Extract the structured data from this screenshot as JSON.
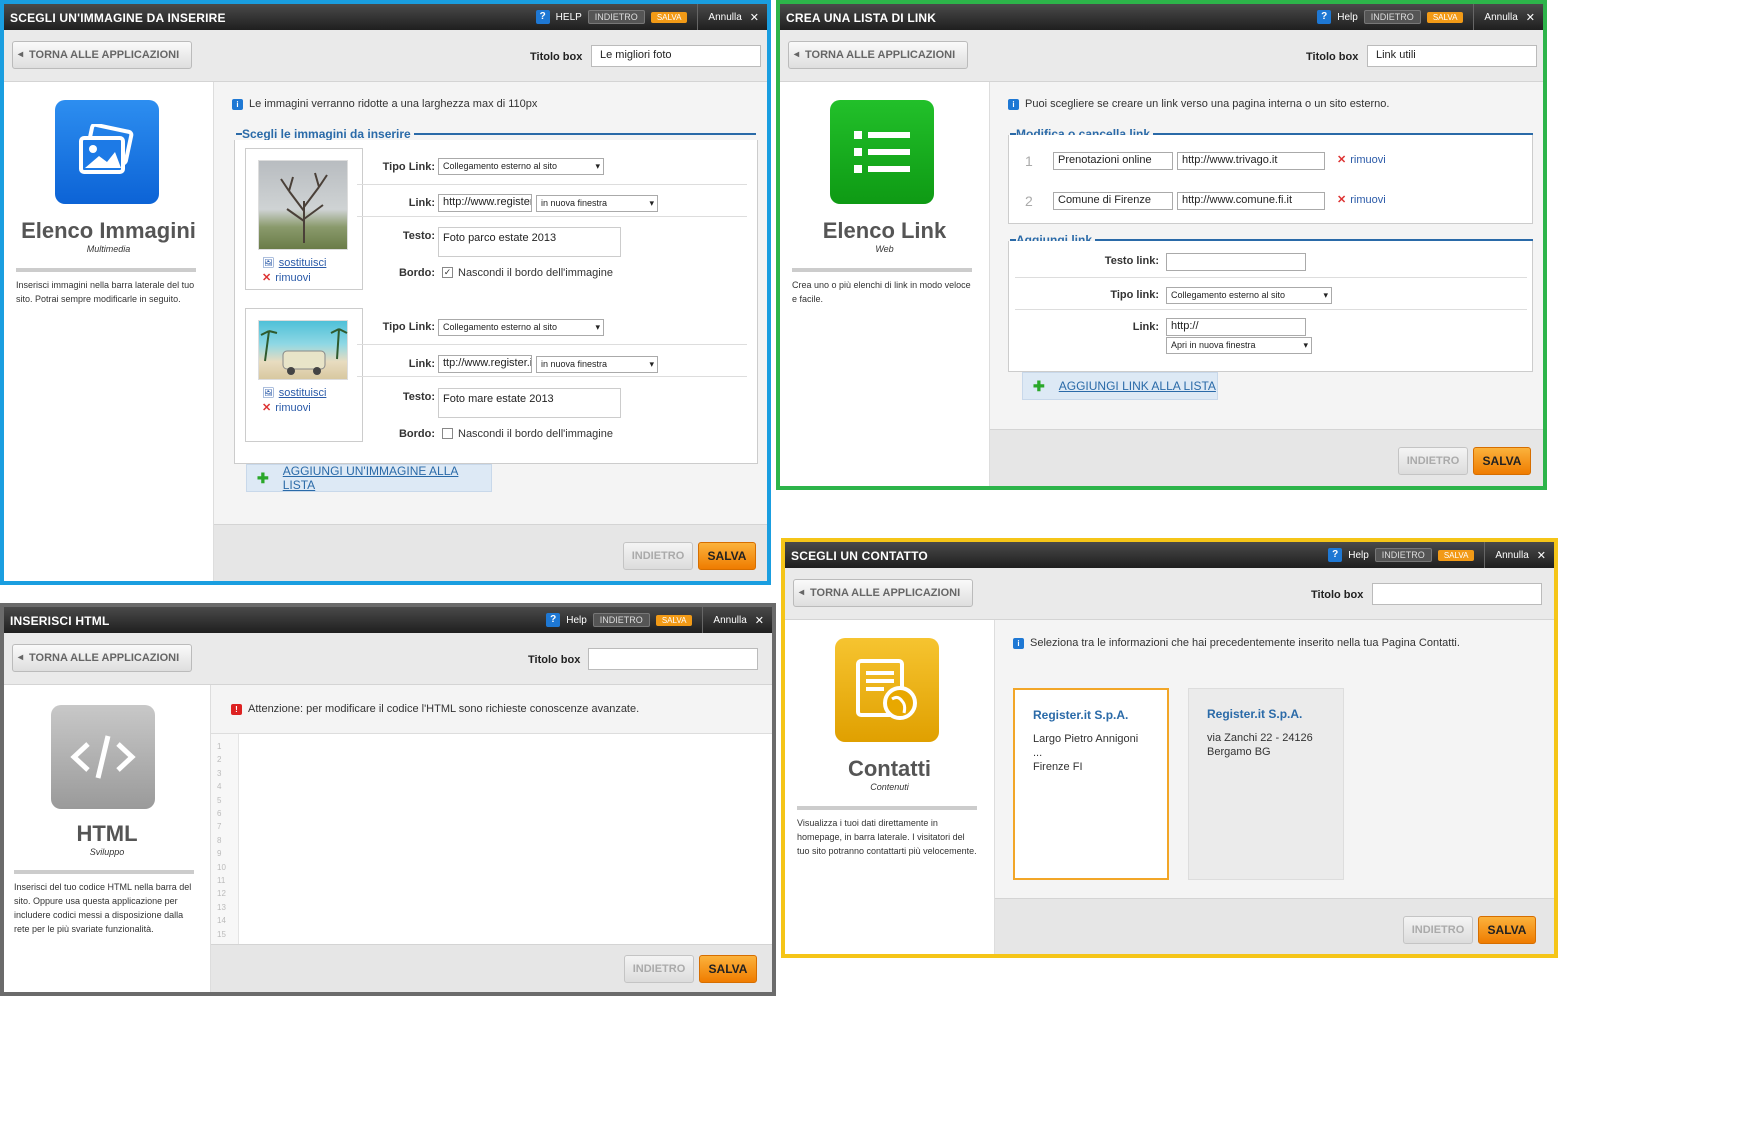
{
  "common": {
    "help": "HELP",
    "help_small": "Help",
    "indietro": "INDIETRO",
    "salva": "SALVA",
    "annulla": "Annulla",
    "back": "TORNA ALLE APPLICAZIONI",
    "titolo_box": "Titolo box",
    "tipo_link_label": "Tipo Link:",
    "link_label": "Link:",
    "testo_label": "Testo:",
    "bordo_label": "Bordo:",
    "sostituisci": "sostituisci",
    "rimuovi": "rimuovi",
    "collegamento": "Collegamento esterno al sito",
    "nuova_finestra": "in nuova finestra",
    "nascondi": "Nascondi il bordo dell'immagine"
  },
  "w1": {
    "title": "SCEGLI UN'IMMAGINE DA INSERIRE",
    "titolo_value": "Le migliori foto",
    "app_name": "Elenco Immagini",
    "app_cat": "Multimedia",
    "desc": "Inserisci immagini nella barra laterale del tuo sito. Potrai sempre modificarle in seguito.",
    "info": "Le immagini verranno ridotte a una larghezza max di 110px",
    "legend": "Scegli le immagini da inserire",
    "img1": {
      "link": "http://www.register",
      "testo": "Foto parco estate 2013",
      "checked": true
    },
    "img2": {
      "link": "ttp://www.register.it",
      "testo": "Foto mare estate 2013",
      "checked": false
    },
    "add": "AGGIUNGI UN'IMMAGINE ALLA LISTA"
  },
  "w2": {
    "title": "CREA UNA LISTA DI LINK",
    "titolo_value": "Link utili",
    "app_name": "Elenco Link",
    "app_cat": "Web",
    "desc": "Crea uno o più elenchi di link in modo veloce e facile.",
    "info": "Puoi scegliere se creare un link verso una pagina interna o un sito esterno.",
    "legend1": "Modifica o cancella link",
    "rows": [
      {
        "n": "1",
        "name": "Prenotazioni online",
        "url": "http://www.trivago.it"
      },
      {
        "n": "2",
        "name": "Comune di Firenze",
        "url": "http://www.comune.fi.it"
      }
    ],
    "legend2": "Aggiungi link",
    "testo_link": "Testo link:",
    "tipo_link": "Tipo link:",
    "link": "Link:",
    "link_value": "http://",
    "apri": "Apri in nuova finestra",
    "add": "AGGIUNGI LINK ALLA LISTA"
  },
  "w3": {
    "title": "INSERISCI HTML",
    "app_name": "HTML",
    "app_cat": "Sviluppo",
    "desc": "Inserisci del tuo codice HTML nella barra del sito. Oppure usa questa applicazione per includere codici messi a disposizione dalla rete per le più svariate funzionalità.",
    "warn": "Attenzione: per modificare il codice l'HTML sono richieste conoscenze avanzate.",
    "lines": [
      "1",
      "2",
      "3",
      "4",
      "5",
      "6",
      "7",
      "8",
      "9",
      "10",
      "11",
      "12",
      "13",
      "14",
      "15"
    ]
  },
  "w4": {
    "title": "SCEGLI UN CONTATTO",
    "app_name": "Contatti",
    "app_cat": "Contenuti",
    "desc": "Visualizza i tuoi dati direttamente in homepage, in barra laterale. I visitatori del tuo sito potranno contattarti più velocemente.",
    "info": "Seleziona tra le informazioni che hai precedentemente inserito nella tua Pagina Contatti.",
    "cards": [
      {
        "name": "Register.it S.p.A.",
        "line1": "Largo Pietro Annigoni ...",
        "line2": "Firenze FI"
      },
      {
        "name": "Register.it S.p.A.",
        "line1": "via Zanchi 22 - 24126",
        "line2": "Bergamo BG"
      }
    ]
  },
  "colors": {
    "w1_border": "#1a9ee0",
    "w2_border": "#2db44a",
    "w3_border": "#6b6b6b",
    "w4_border": "#f5c518",
    "accent": "#ef7c00",
    "link": "#2a6aa8"
  }
}
